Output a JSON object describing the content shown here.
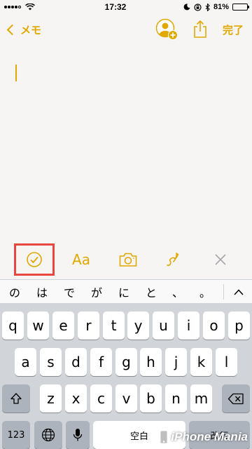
{
  "status_bar": {
    "time": "17:32",
    "battery": "81%",
    "battery_level": 0.81
  },
  "nav": {
    "back_label": "メモ",
    "done_label": "完了"
  },
  "colors": {
    "accent": "#e0a800",
    "highlight": "#e8473f"
  },
  "toolbar": {
    "icons": [
      "checklist-icon",
      "text-format-icon",
      "camera-icon",
      "sketch-icon",
      "close-icon"
    ],
    "format_label": "Aa"
  },
  "predictions": [
    "の",
    "は",
    "で",
    "が",
    "に",
    "と",
    "、",
    "。"
  ],
  "keyboard": {
    "row1": [
      "q",
      "w",
      "e",
      "r",
      "t",
      "y",
      "u",
      "i",
      "o",
      "p"
    ],
    "row2": [
      "a",
      "s",
      "d",
      "f",
      "g",
      "h",
      "j",
      "k",
      "l"
    ],
    "row3": [
      "z",
      "x",
      "c",
      "v",
      "b",
      "n",
      "m"
    ],
    "numbers_label": "123",
    "space_label": "空白",
    "return_label": "改行"
  },
  "watermark": {
    "text": "iPhone Mania"
  }
}
